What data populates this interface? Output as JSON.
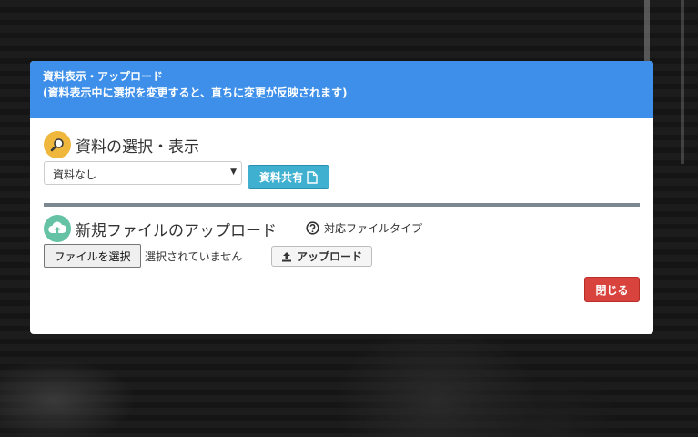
{
  "colors": {
    "header_bg": "#3d8fe9",
    "share_button": "#3fb0cf",
    "close_button": "#d9433d",
    "divider": "#7c8890",
    "search_icon_bg": "#f0b73d",
    "upload_icon_bg": "#66c2a5"
  },
  "header": {
    "title": "資料表示・アップロード",
    "subtitle": "(資料表示中に選択を変更すると、直ちに変更が反映されます)"
  },
  "material_section": {
    "icon": "search-icon",
    "title": "資料の選択・表示",
    "select_value": "資料なし",
    "share_button": "資料共有",
    "share_icon": "document-icon"
  },
  "upload_section": {
    "icon": "cloud-upload-icon",
    "title": "新規ファイルのアップロード",
    "help_icon": "question-circle-icon",
    "help_text": "対応ファイルタイプ",
    "file_button": "ファイルを選択",
    "file_status": "選択されていません",
    "upload_button": "アップロード",
    "upload_icon": "upload-arrow-icon"
  },
  "footer": {
    "close_button": "閉じる"
  }
}
